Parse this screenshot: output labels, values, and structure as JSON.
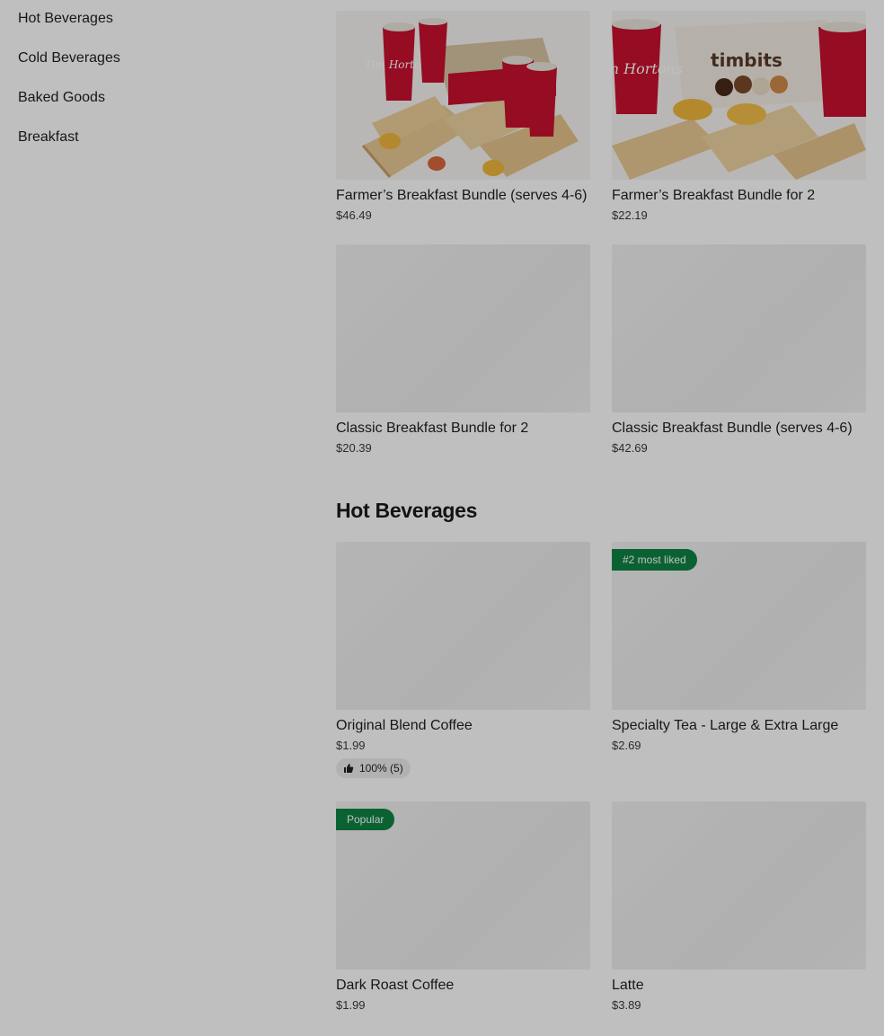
{
  "sidebar": {
    "items": [
      {
        "label": "Hot Beverages"
      },
      {
        "label": "Cold Beverages"
      },
      {
        "label": "Baked Goods"
      },
      {
        "label": "Breakfast"
      }
    ]
  },
  "bundles": [
    {
      "name": "Farmer’s Breakfast Bundle (serves 4-6)",
      "price": "$46.49"
    },
    {
      "name": "Farmer’s Breakfast Bundle for 2",
      "price": "$22.19"
    },
    {
      "name": "Classic Breakfast Bundle for 2",
      "price": "$20.39"
    },
    {
      "name": "Classic Breakfast Bundle (serves 4-6)",
      "price": "$42.69"
    }
  ],
  "hot_beverages": {
    "title": "Hot Beverages",
    "items": [
      {
        "name": "Original Blend Coffee",
        "price": "$1.99",
        "rating": "100% (5)"
      },
      {
        "name": "Specialty Tea - Large & Extra Large",
        "price": "$2.69",
        "badge": "#2 most liked"
      },
      {
        "name": "Dark Roast Coffee",
        "price": "$1.99",
        "badge": "Popular"
      },
      {
        "name": "Latte",
        "price": "$3.89"
      }
    ]
  },
  "images": {
    "cup_logo_1": "Tim Hortons",
    "cup_logo_2": "Tim Hortons",
    "box_logo": "timbits"
  },
  "colors": {
    "badge_green": "#0e8345",
    "cup_red": "#c8102e",
    "overlay": "rgba(0,0,0,0.25)"
  }
}
